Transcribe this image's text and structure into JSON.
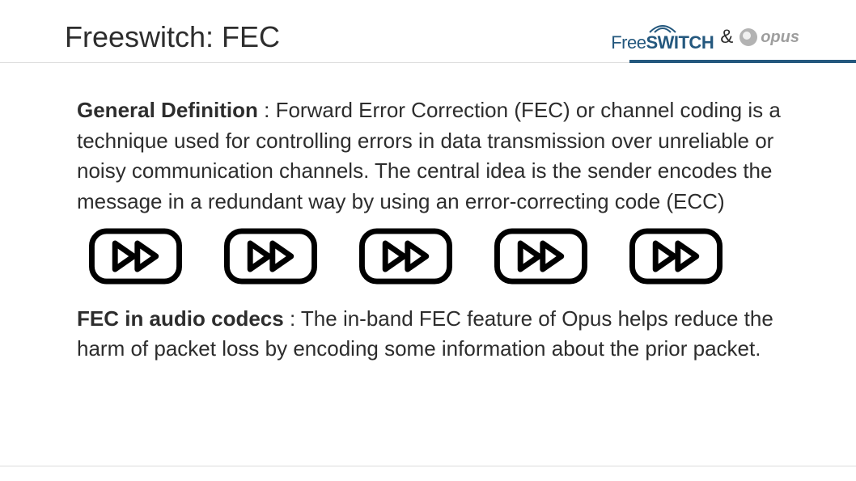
{
  "header": {
    "title": "Freeswitch: FEC",
    "freeswitch_brand_prefix": "Free",
    "freeswitch_brand_suffix": "SWITCH",
    "ampersand": "&",
    "opus_brand": "opus"
  },
  "paragraph1": {
    "label": "General Definition",
    "text": " : Forward Error Correction (FEC) or channel coding is a technique used for controlling errors in data transmission over unreliable or noisy communication channels. The central idea is the sender encodes the message in a redundant way by using an error-correcting code (ECC)"
  },
  "paragraph2": {
    "label": "FEC in audio codecs",
    "text": " : The in-band FEC feature of Opus helps reduce the harm of packet loss by encoding some information about the prior packet."
  },
  "icon_count": 5
}
